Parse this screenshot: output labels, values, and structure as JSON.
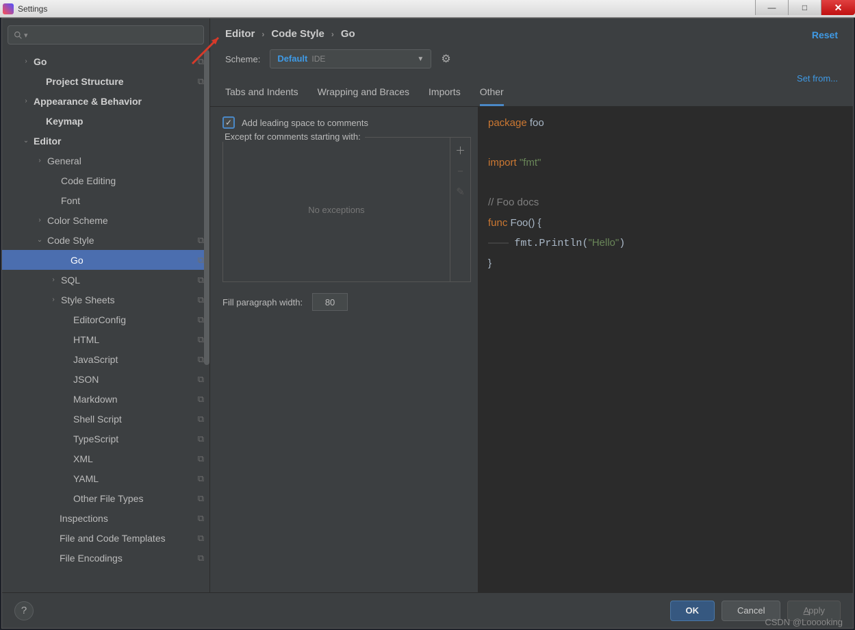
{
  "window": {
    "title": "Settings"
  },
  "search": {
    "placeholder": ""
  },
  "tree": [
    {
      "label": "Go",
      "indent": 28,
      "chev": "›",
      "bold": true,
      "cfg": true
    },
    {
      "label": "Project Structure",
      "indent": 46,
      "chev": "",
      "bold": true,
      "cfg": true
    },
    {
      "label": "Appearance & Behavior",
      "indent": 28,
      "chev": "›",
      "bold": true,
      "cfg": false
    },
    {
      "label": "Keymap",
      "indent": 46,
      "chev": "",
      "bold": true,
      "cfg": false
    },
    {
      "label": "Editor",
      "indent": 28,
      "chev": "⌄",
      "bold": true,
      "cfg": false
    },
    {
      "label": "General",
      "indent": 48,
      "chev": "›",
      "bold": false,
      "cfg": false
    },
    {
      "label": "Code Editing",
      "indent": 68,
      "chev": "",
      "bold": false,
      "cfg": false
    },
    {
      "label": "Font",
      "indent": 68,
      "chev": "",
      "bold": false,
      "cfg": false
    },
    {
      "label": "Color Scheme",
      "indent": 48,
      "chev": "›",
      "bold": false,
      "cfg": false
    },
    {
      "label": "Code Style",
      "indent": 48,
      "chev": "⌄",
      "bold": false,
      "cfg": true
    },
    {
      "label": "Go",
      "indent": 82,
      "chev": "",
      "bold": false,
      "cfg": true,
      "selected": true
    },
    {
      "label": "SQL",
      "indent": 68,
      "chev": "›",
      "bold": false,
      "cfg": true
    },
    {
      "label": "Style Sheets",
      "indent": 68,
      "chev": "›",
      "bold": false,
      "cfg": true
    },
    {
      "label": "EditorConfig",
      "indent": 86,
      "chev": "",
      "bold": false,
      "cfg": true
    },
    {
      "label": "HTML",
      "indent": 86,
      "chev": "",
      "bold": false,
      "cfg": true
    },
    {
      "label": "JavaScript",
      "indent": 86,
      "chev": "",
      "bold": false,
      "cfg": true
    },
    {
      "label": "JSON",
      "indent": 86,
      "chev": "",
      "bold": false,
      "cfg": true
    },
    {
      "label": "Markdown",
      "indent": 86,
      "chev": "",
      "bold": false,
      "cfg": true
    },
    {
      "label": "Shell Script",
      "indent": 86,
      "chev": "",
      "bold": false,
      "cfg": true
    },
    {
      "label": "TypeScript",
      "indent": 86,
      "chev": "",
      "bold": false,
      "cfg": true
    },
    {
      "label": "XML",
      "indent": 86,
      "chev": "",
      "bold": false,
      "cfg": true
    },
    {
      "label": "YAML",
      "indent": 86,
      "chev": "",
      "bold": false,
      "cfg": true
    },
    {
      "label": "Other File Types",
      "indent": 86,
      "chev": "",
      "bold": false,
      "cfg": true
    },
    {
      "label": "Inspections",
      "indent": 66,
      "chev": "",
      "bold": false,
      "cfg": true
    },
    {
      "label": "File and Code Templates",
      "indent": 66,
      "chev": "",
      "bold": false,
      "cfg": true
    },
    {
      "label": "File Encodings",
      "indent": 66,
      "chev": "",
      "bold": false,
      "cfg": true
    }
  ],
  "breadcrumb": [
    "Editor",
    "Code Style",
    "Go"
  ],
  "links": {
    "reset": "Reset",
    "setFrom": "Set from..."
  },
  "scheme": {
    "label": "Scheme:",
    "value": "Default",
    "badge": "IDE"
  },
  "tabs": [
    "Tabs and Indents",
    "Wrapping and Braces",
    "Imports",
    "Other"
  ],
  "activeTab": 3,
  "form": {
    "checkboxLabel": "Add leading space to comments",
    "exceptLabel": "Except for comments starting with:",
    "noExceptions": "No exceptions",
    "fillWidthLabel": "Fill paragraph width:",
    "fillWidthValue": "80"
  },
  "preview": {
    "l1a": "package",
    "l1b": " foo",
    "l2a": "import",
    "l2b": " \"fmt\"",
    "l3": "// Foo docs",
    "l4a": "func",
    "l4b": " Foo() {",
    "l5a": "    fmt.Println(",
    "l5b": "\"Hello\"",
    "l5c": ")",
    "l6": "}"
  },
  "footer": {
    "ok": "OK",
    "cancel": "Cancel",
    "apply": "Apply"
  },
  "watermark": "CSDN @Looooking"
}
